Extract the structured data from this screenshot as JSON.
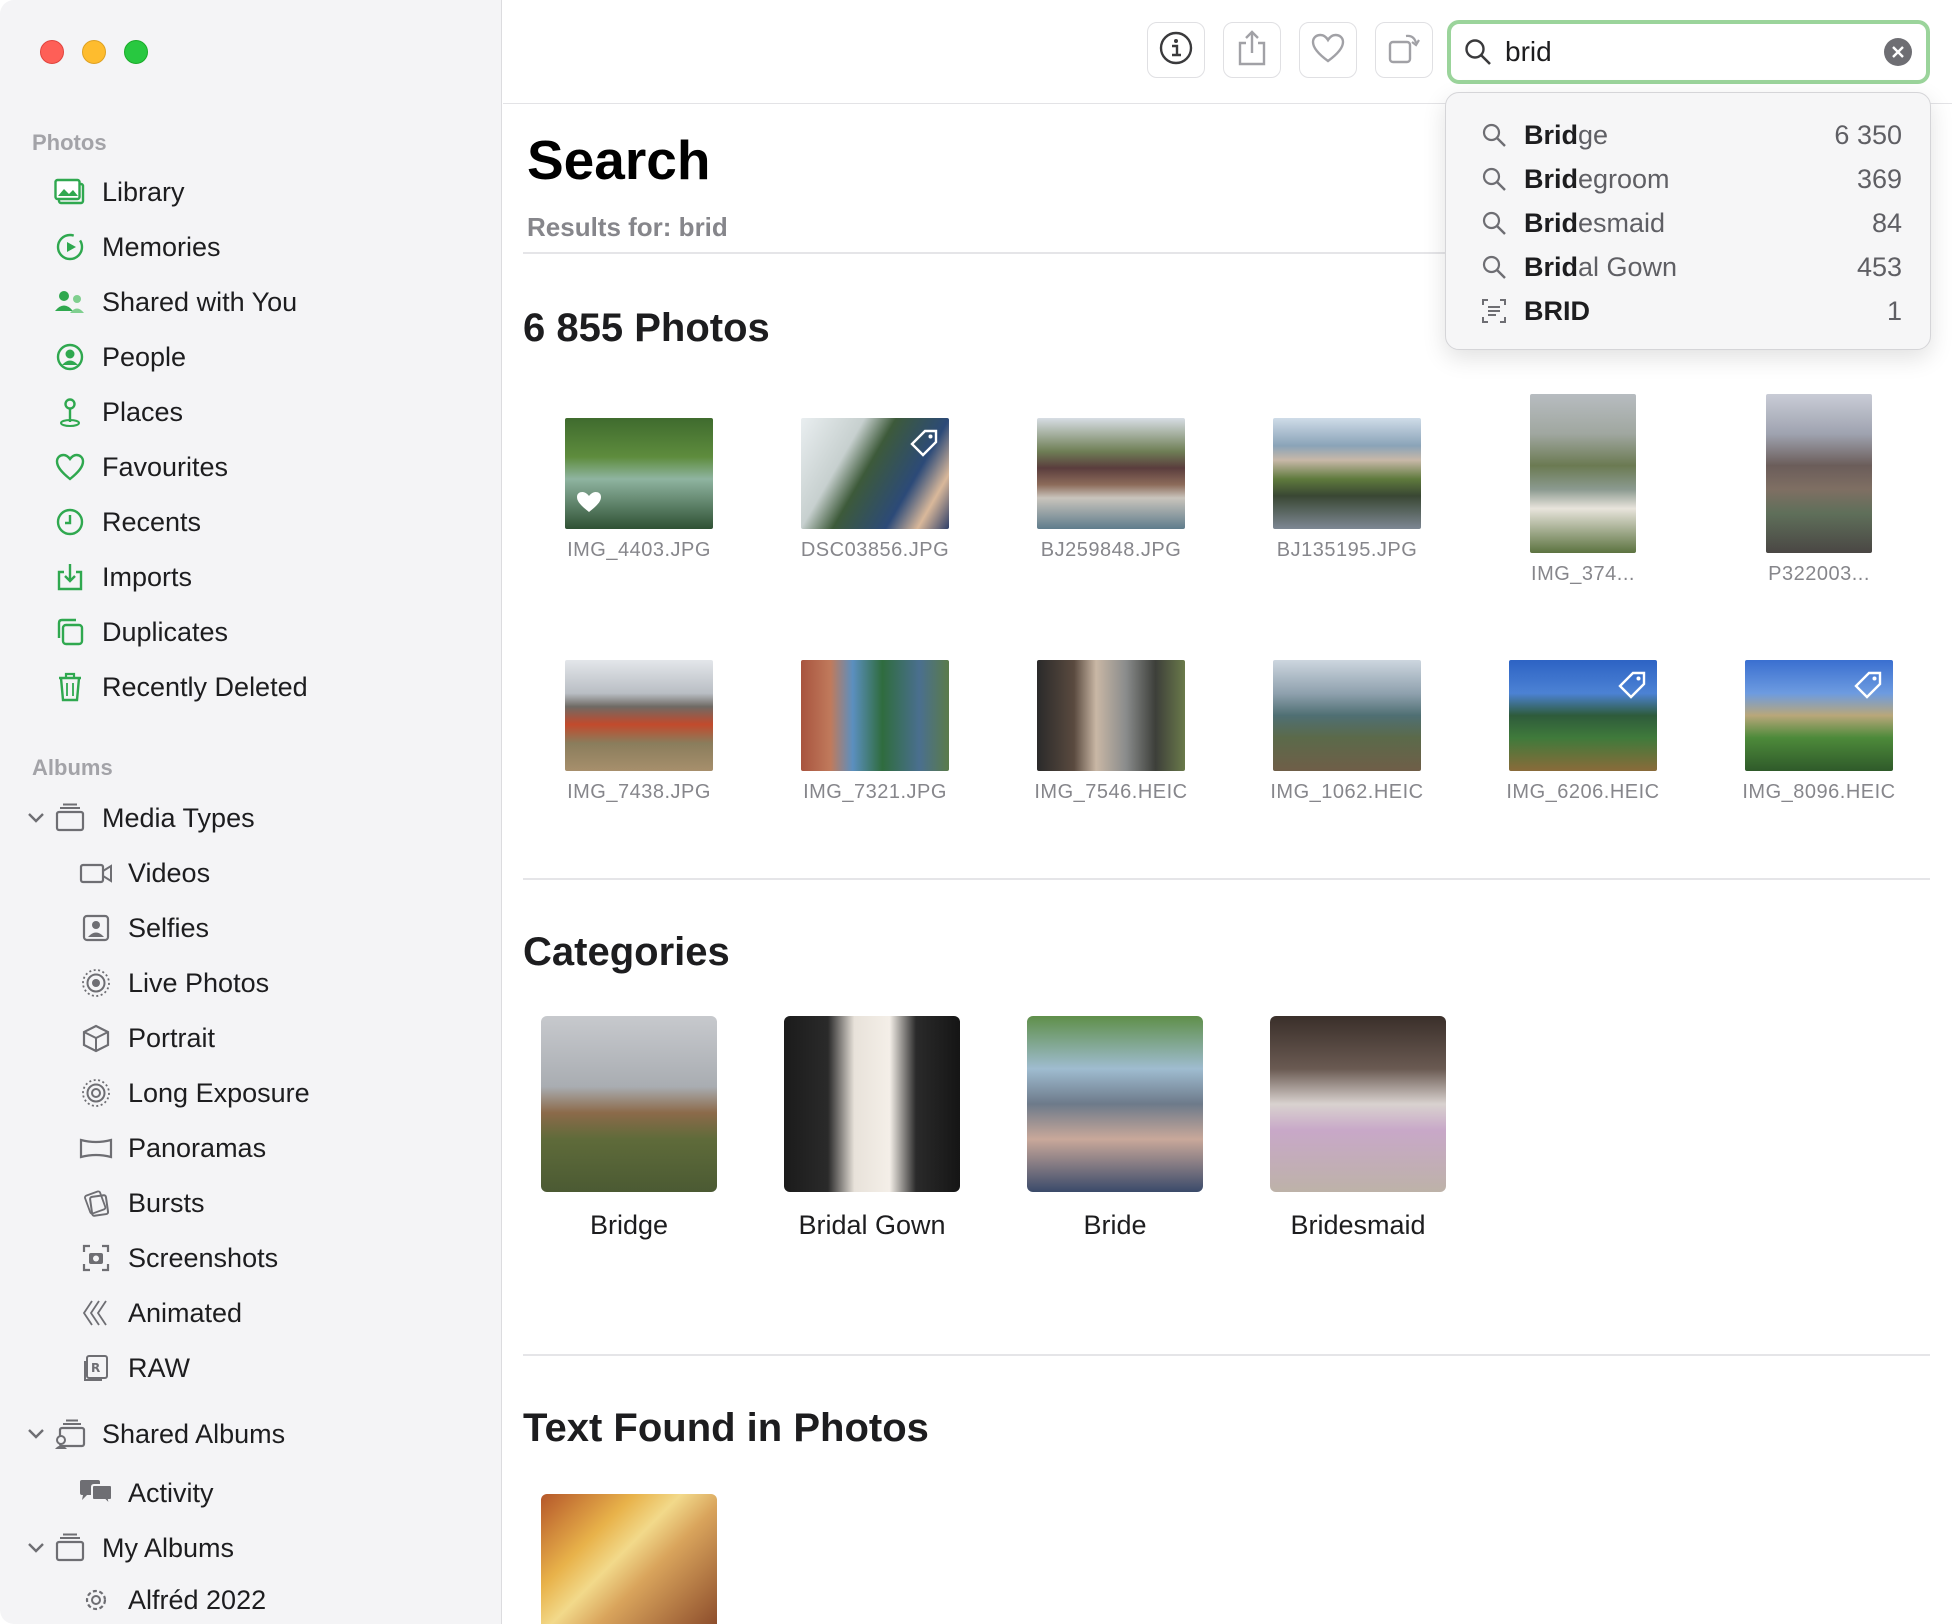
{
  "window": {
    "search_query": "brid"
  },
  "sidebar": {
    "photos_header": "Photos",
    "photos_items": [
      {
        "label": "Library",
        "icon": "library-icon"
      },
      {
        "label": "Memories",
        "icon": "memories-icon"
      },
      {
        "label": "Shared with You",
        "icon": "shared-with-you-icon"
      },
      {
        "label": "People",
        "icon": "people-icon"
      },
      {
        "label": "Places",
        "icon": "places-icon"
      },
      {
        "label": "Favourites",
        "icon": "heart-icon"
      },
      {
        "label": "Recents",
        "icon": "clock-icon"
      },
      {
        "label": "Imports",
        "icon": "import-icon"
      },
      {
        "label": "Duplicates",
        "icon": "duplicates-icon"
      },
      {
        "label": "Recently Deleted",
        "icon": "trash-icon"
      }
    ],
    "albums_header": "Albums",
    "media_types": {
      "label": "Media Types",
      "items": [
        "Videos",
        "Selfies",
        "Live Photos",
        "Portrait",
        "Long Exposure",
        "Panoramas",
        "Bursts",
        "Screenshots",
        "Animated",
        "RAW"
      ]
    },
    "shared_albums": {
      "label": "Shared Albums",
      "items": [
        "Activity"
      ]
    },
    "my_albums": {
      "label": "My Albums",
      "items": [
        "Alfréd 2022"
      ]
    }
  },
  "main": {
    "title": "Search",
    "results_for": "Results for: brid",
    "photos_heading": "6 855 Photos",
    "photos": [
      "IMG_4403.JPG",
      "DSC03856.JPG",
      "BJ259848.JPG",
      "BJ135195.JPG",
      "IMG_374...",
      "P322003...",
      "IMG_7438.JPG",
      "IMG_7321.JPG",
      "IMG_7546.HEIC",
      "IMG_1062.HEIC",
      "IMG_6206.HEIC",
      "IMG_8096.HEIC"
    ],
    "categories_heading": "Categories",
    "categories": [
      "Bridge",
      "Bridal Gown",
      "Bride",
      "Bridesmaid"
    ],
    "text_found_heading": "Text Found in Photos"
  },
  "suggestions": [
    {
      "bold": "Brid",
      "rest": "ge",
      "count": "6 350",
      "icon": "search-icon"
    },
    {
      "bold": "Brid",
      "rest": "egroom",
      "count": "369",
      "icon": "search-icon"
    },
    {
      "bold": "Brid",
      "rest": "esmaid",
      "count": "84",
      "icon": "search-icon"
    },
    {
      "bold": "Brid",
      "rest": "al Gown",
      "count": "453",
      "icon": "search-icon"
    },
    {
      "bold": "BRID",
      "rest": "",
      "count": "1",
      "icon": "text-scan-icon"
    }
  ],
  "colors": {
    "accent": "#2fa84f",
    "search_focus": "#9bd49b"
  }
}
